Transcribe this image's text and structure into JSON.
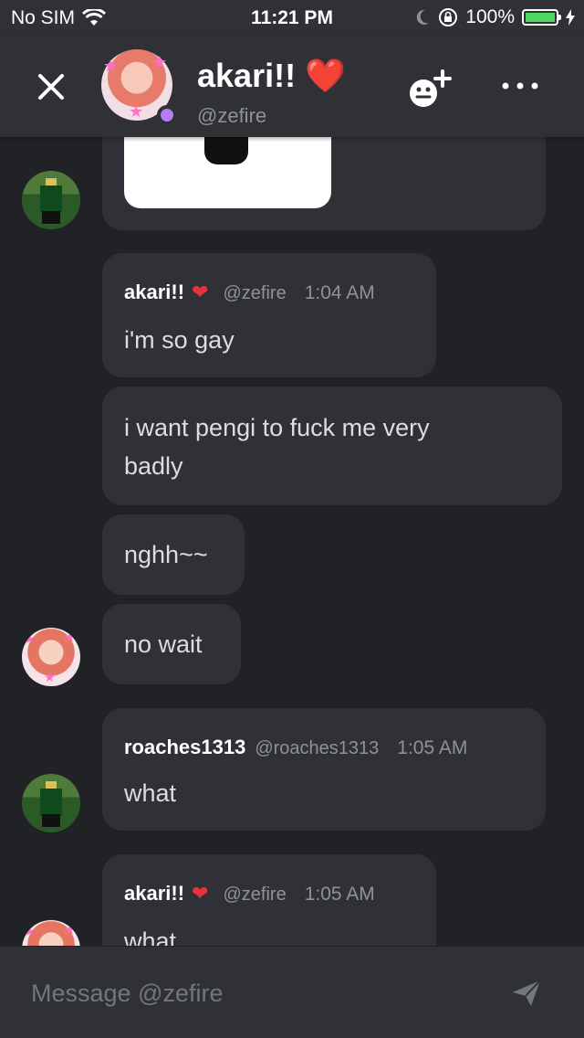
{
  "status_bar": {
    "carrier": "No SIM",
    "time": "11:21 PM",
    "battery": "100%",
    "battery_level": 1.0
  },
  "header": {
    "name": "akari!! ❤️",
    "handle": "@zefire",
    "presence_color": "#b57bf0"
  },
  "messages": [
    {
      "author": "akari!!",
      "heart": "❤",
      "handle": "@zefire",
      "time": "1:04 AM",
      "lines": [
        "i'm so gay",
        "i want pengi to fuck me very\nbadly",
        "nghh~~",
        "no wait"
      ]
    },
    {
      "author": "roaches1313",
      "handle": "@roaches1313",
      "time": "1:05 AM",
      "lines": [
        "what"
      ]
    },
    {
      "author": "akari!!",
      "heart": "❤",
      "handle": "@zefire",
      "time": "1:05 AM",
      "lines": [
        "what"
      ]
    }
  ],
  "composer": {
    "placeholder": "Message @zefire"
  },
  "icons": {
    "wifi": "wifi-icon",
    "moon": "moon-icon",
    "rotation_lock": "rotation-lock-icon",
    "close": "close-icon",
    "add_friend": "add-friend-icon",
    "more": "more-icon",
    "send": "send-icon"
  },
  "colors": {
    "background": "#202225",
    "bubble": "#2f3136",
    "heart": "#e8323c",
    "battery": "#4cd964"
  }
}
